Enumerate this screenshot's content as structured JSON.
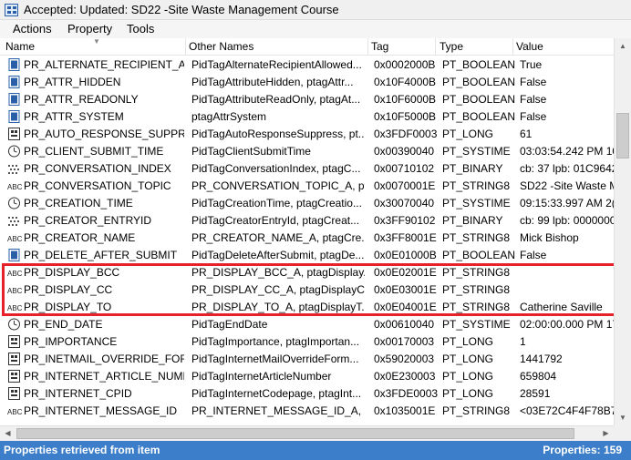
{
  "window": {
    "title": "Accepted: Updated: SD22 -Site Waste Management Course"
  },
  "menu": {
    "items": [
      "Actions",
      "Property",
      "Tools"
    ]
  },
  "columns": [
    "Name",
    "Other Names",
    "Tag",
    "Type",
    "Value"
  ],
  "rows": [
    {
      "icon": "bool",
      "name": "PR_ALTERNATE_RECIPIENT_AL...",
      "other": "PidTagAlternateRecipientAllowed...",
      "tag": "0x0002000B",
      "type": "PT_BOOLEAN",
      "value": "True"
    },
    {
      "icon": "bool",
      "name": "PR_ATTR_HIDDEN",
      "other": "PidTagAttributeHidden, ptagAttr...",
      "tag": "0x10F4000B",
      "type": "PT_BOOLEAN",
      "value": "False"
    },
    {
      "icon": "bool",
      "name": "PR_ATTR_READONLY",
      "other": "PidTagAttributeReadOnly, ptagAt...",
      "tag": "0x10F6000B",
      "type": "PT_BOOLEAN",
      "value": "False"
    },
    {
      "icon": "bool",
      "name": "PR_ATTR_SYSTEM",
      "other": "ptagAttrSystem",
      "tag": "0x10F5000B",
      "type": "PT_BOOLEAN",
      "value": "False"
    },
    {
      "icon": "long",
      "name": "PR_AUTO_RESPONSE_SUPPRESS",
      "other": "PidTagAutoResponseSuppress, pt...",
      "tag": "0x3FDF0003",
      "type": "PT_LONG",
      "value": "61"
    },
    {
      "icon": "time",
      "name": "PR_CLIENT_SUBMIT_TIME",
      "other": "PidTagClientSubmitTime",
      "tag": "0x00390040",
      "type": "PT_SYSTIME",
      "value": "03:03:54.242 PM 10/"
    },
    {
      "icon": "bin",
      "name": "PR_CONVERSATION_INDEX",
      "other": "PidTagConversationIndex, ptagC...",
      "tag": "0x00710102",
      "type": "PT_BINARY",
      "value": "cb: 37 lpb: 01C9642"
    },
    {
      "icon": "str",
      "name": "PR_CONVERSATION_TOPIC",
      "other": "PR_CONVERSATION_TOPIC_A, pt...",
      "tag": "0x0070001E",
      "type": "PT_STRING8",
      "value": "SD22 -Site Waste M"
    },
    {
      "icon": "time",
      "name": "PR_CREATION_TIME",
      "other": "PidTagCreationTime, ptagCreatio...",
      "tag": "0x30070040",
      "type": "PT_SYSTIME",
      "value": "09:15:33.997 AM 2("
    },
    {
      "icon": "bin",
      "name": "PR_CREATOR_ENTRYID",
      "other": "PidTagCreatorEntryId, ptagCreat...",
      "tag": "0x3FF90102",
      "type": "PT_BINARY",
      "value": "cb: 99 lpb: 00000000"
    },
    {
      "icon": "str",
      "name": "PR_CREATOR_NAME",
      "other": "PR_CREATOR_NAME_A, ptagCre...",
      "tag": "0x3FF8001E",
      "type": "PT_STRING8",
      "value": "Mick Bishop"
    },
    {
      "icon": "bool",
      "name": "PR_DELETE_AFTER_SUBMIT",
      "other": "PidTagDeleteAfterSubmit, ptagDe...",
      "tag": "0x0E01000B",
      "type": "PT_BOOLEAN",
      "value": "False"
    },
    {
      "icon": "str",
      "name": "PR_DISPLAY_BCC",
      "other": "PR_DISPLAY_BCC_A, ptagDisplay...",
      "tag": "0x0E02001E",
      "type": "PT_STRING8",
      "value": ""
    },
    {
      "icon": "str",
      "name": "PR_DISPLAY_CC",
      "other": "PR_DISPLAY_CC_A, ptagDisplayC...",
      "tag": "0x0E03001E",
      "type": "PT_STRING8",
      "value": ""
    },
    {
      "icon": "str",
      "name": "PR_DISPLAY_TO",
      "other": "PR_DISPLAY_TO_A, ptagDisplayT...",
      "tag": "0x0E04001E",
      "type": "PT_STRING8",
      "value": "Catherine Saville"
    },
    {
      "icon": "time",
      "name": "PR_END_DATE",
      "other": "PidTagEndDate",
      "tag": "0x00610040",
      "type": "PT_SYSTIME",
      "value": "02:00:00.000 PM 17/"
    },
    {
      "icon": "long",
      "name": "PR_IMPORTANCE",
      "other": "PidTagImportance, ptagImportan...",
      "tag": "0x00170003",
      "type": "PT_LONG",
      "value": "1"
    },
    {
      "icon": "long",
      "name": "PR_INETMAIL_OVERRIDE_FOR...",
      "other": "PidTagInternetMailOverrideForm...",
      "tag": "0x59020003",
      "type": "PT_LONG",
      "value": "1441792"
    },
    {
      "icon": "long",
      "name": "PR_INTERNET_ARTICLE_NUMBER",
      "other": "PidTagInternetArticleNumber",
      "tag": "0x0E230003",
      "type": "PT_LONG",
      "value": "659804"
    },
    {
      "icon": "long",
      "name": "PR_INTERNET_CPID",
      "other": "PidTagInternetCodepage, ptagInt...",
      "tag": "0x3FDE0003",
      "type": "PT_LONG",
      "value": "28591"
    },
    {
      "icon": "str",
      "name": "PR_INTERNET_MESSAGE_ID",
      "other": "PR_INTERNET_MESSAGE_ID_A, PR...",
      "tag": "0x1035001E",
      "type": "PT_STRING8",
      "value": "<03E72C4F4F78B74"
    }
  ],
  "status": {
    "left": "Properties retrieved from item",
    "right": "Properties: 159"
  },
  "colors": {
    "accent": "#3c7ec9",
    "highlight": "#e8202a",
    "icon": "#2a5fa8"
  }
}
